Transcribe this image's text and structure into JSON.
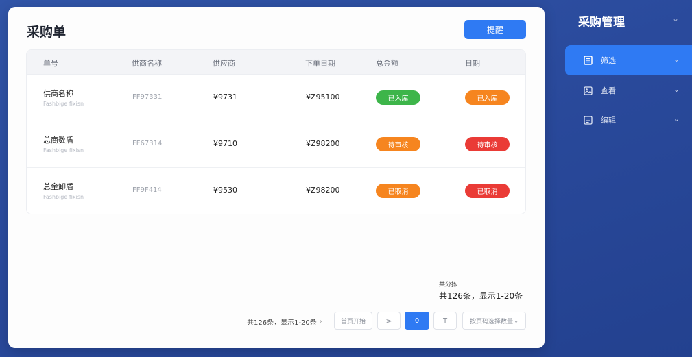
{
  "panel": {
    "title": "采购单",
    "primary_button": "提醒"
  },
  "table": {
    "headers": [
      "单号",
      "供商名称",
      "供应商",
      "下单日期",
      "总金额",
      "日期"
    ],
    "rows": [
      {
        "name": "供商名称",
        "sub": "Fashbige fixisn",
        "code": "FF97331",
        "price": "¥9731",
        "total": "¥Z95100",
        "status1": "已入库",
        "status1_color": "#3db54a",
        "status2": "已入库",
        "status2_color": "#f6851f"
      },
      {
        "name": "总商数盾",
        "sub": "Fashbige fixisn",
        "code": "FF67314",
        "price": "¥9710",
        "total": "¥Z98200",
        "status1": "待审核",
        "status1_color": "#f6851f",
        "status2": "待审核",
        "status2_color": "#ea3b36"
      },
      {
        "name": "总金卸盾",
        "sub": "Fashbige fixisn",
        "code": "FF9F414",
        "price": "¥9530",
        "total": "¥Z98200",
        "status1": "已取消",
        "status1_color": "#f6851f",
        "status2": "已取消",
        "status2_color": "#ea3b36"
      }
    ]
  },
  "summary": {
    "label": "共分拣",
    "text": "共126条，显示1-20条"
  },
  "pager": {
    "info": "共126条，显示1-20条",
    "info_chevron": "›",
    "btn_prev_label": "首页开始",
    "btn_next": ">",
    "btn_active": "0",
    "btn_page": "T",
    "select_label": "按页码选择数量"
  },
  "sidebar": {
    "title": "采购管理",
    "items": [
      {
        "label": "筛选",
        "icon": "document-icon",
        "active": true
      },
      {
        "label": "查看",
        "icon": "image-icon",
        "active": false
      },
      {
        "label": "编辑",
        "icon": "list-icon",
        "active": false
      }
    ]
  },
  "colors": {
    "accent": "#2f7af3",
    "green": "#3db54a",
    "orange": "#f6851f",
    "red": "#ea3b36",
    "background": "#2a4a9c"
  }
}
